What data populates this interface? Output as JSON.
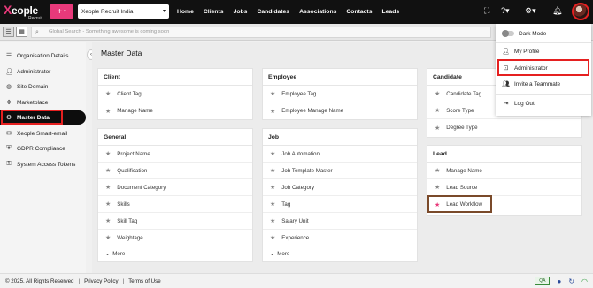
{
  "topbar": {
    "logo_text": "eople",
    "logo_x": "X",
    "logo_sub": "Recruit",
    "plus_label": "+",
    "company": "Xeople Recruit India",
    "nav": [
      "Home",
      "Clients",
      "Jobs",
      "Candidates",
      "Associations",
      "Contacts",
      "Leads"
    ]
  },
  "search": {
    "placeholder": "Global Search - Something awesome is coming soon"
  },
  "sidebar": {
    "items": [
      {
        "label": "Organisation Details",
        "icon": "list-icon"
      },
      {
        "label": "Administrator",
        "icon": "user-icon"
      },
      {
        "label": "Site Domain",
        "icon": "globe-icon"
      },
      {
        "label": "Marketplace",
        "icon": "shop-icon"
      },
      {
        "label": "Master Data",
        "icon": "gear-icon"
      },
      {
        "label": "Xeople Smart-email",
        "icon": "mail-icon"
      },
      {
        "label": "GDPR Compliance",
        "icon": "shield-icon"
      },
      {
        "label": "System Access Tokens",
        "icon": "key-icon"
      }
    ],
    "active_index": 4
  },
  "main": {
    "title": "Master Data",
    "panels": {
      "client": {
        "title": "Client",
        "items": [
          "Client Tag",
          "Manage Name"
        ]
      },
      "employee": {
        "title": "Employee",
        "items": [
          "Employee Tag",
          "Employee Manage Name"
        ]
      },
      "candidate": {
        "title": "Candidate",
        "items": [
          "Candidate Tag",
          "Score Type",
          "Degree Type"
        ]
      },
      "general": {
        "title": "General",
        "items": [
          "Project Name",
          "Qualification",
          "Document Category",
          "Skills",
          "Skill Tag",
          "Weightage"
        ],
        "more": "More"
      },
      "job": {
        "title": "Job",
        "items": [
          "Job Automation",
          "Job Template Master",
          "Job Category",
          "Tag",
          "Salary Unit",
          "Experience"
        ],
        "more": "More"
      },
      "lead": {
        "title": "Lead",
        "items": [
          "Manage Name",
          "Lead Source",
          "Lead Workflow"
        ]
      }
    }
  },
  "dropdown": {
    "dark_mode": "Dark Mode",
    "my_profile": "My Profile",
    "administrator": "Administrator",
    "invite": "Invite a Teammate",
    "logout": "Log Out"
  },
  "footer": {
    "copyright": "© 2025. All Rights Reserved",
    "privacy": "Privacy Policy",
    "terms": "Terms of Use",
    "qa": "QA"
  },
  "colors": {
    "accent": "#e8397a",
    "topbar": "#111111",
    "highlight": "#e52020"
  }
}
